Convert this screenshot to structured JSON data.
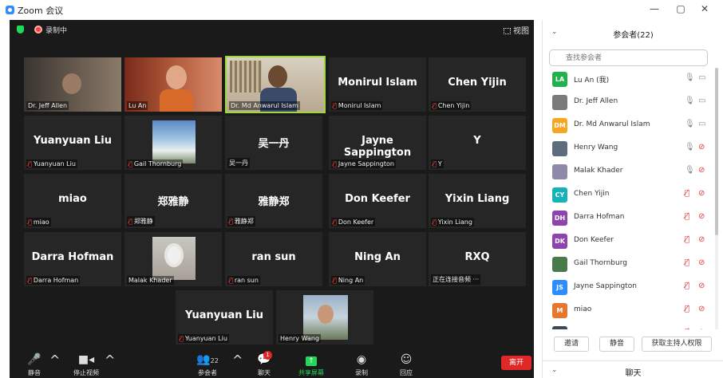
{
  "window": {
    "title": "Zoom 会议",
    "minimize": "—",
    "restore": "▢",
    "close": "✕"
  },
  "meeting": {
    "recording_label": "录制中",
    "view_label": "视图",
    "tiles": [
      {
        "name": "Dr. Jeff Allen",
        "big": "",
        "muted": false
      },
      {
        "name": "Lu An",
        "big": "",
        "muted": false
      },
      {
        "name": "Dr. Md Anwarul Islam",
        "big": "",
        "muted": false
      },
      {
        "name": "Monirul Islam",
        "big": "Monirul Islam",
        "muted": true
      },
      {
        "name": "Chen Yijin",
        "big": "Chen Yijin",
        "muted": true
      },
      {
        "name": "Yuanyuan Liu",
        "big": "Yuanyuan Liu",
        "muted": true
      },
      {
        "name": "Gail Thornburg",
        "big": "",
        "muted": true
      },
      {
        "name": "吴一丹",
        "big": "吴一丹",
        "muted": false
      },
      {
        "name": "Jayne Sappington",
        "big": "Jayne Sappington",
        "muted": true
      },
      {
        "name": "Y",
        "big": "Y",
        "muted": true
      },
      {
        "name": "miao",
        "big": "miao",
        "muted": true
      },
      {
        "name": "郑雅静",
        "big": "郑雅静",
        "muted": true
      },
      {
        "name": "雅静郑",
        "big": "雅静郑",
        "muted": true
      },
      {
        "name": "Don Keefer",
        "big": "Don Keefer",
        "muted": true
      },
      {
        "name": "Yixin Liang",
        "big": "Yixin Liang",
        "muted": true
      },
      {
        "name": "Darra Hofman",
        "big": "Darra Hofman",
        "muted": true
      },
      {
        "name": "Malak Khader",
        "big": "",
        "muted": false
      },
      {
        "name": "ran sun",
        "big": "ran sun",
        "muted": true
      },
      {
        "name": "Ning An",
        "big": "Ning An",
        "muted": true
      },
      {
        "name": "正在连接音频 ···",
        "big": "RXQ",
        "muted": false
      },
      {
        "name": "Yuanyuan Liu",
        "big": "Yuanyuan Liu",
        "muted": true
      },
      {
        "name": "Henry Wang",
        "big": "",
        "muted": false
      }
    ]
  },
  "toolbar": {
    "mute": "静音",
    "stop_video": "停止视频",
    "participants": "参会者",
    "participants_count": "22",
    "chat": "聊天",
    "chat_badge": "1",
    "share_screen": "共享屏幕",
    "record": "录制",
    "reactions": "回应",
    "leave": "离开"
  },
  "panel": {
    "title": "参会者(22)",
    "search_placeholder": "查找参会者",
    "participants": [
      {
        "initials": "LA",
        "name": "Lu An (我)",
        "color": "#23b14d",
        "photo": false,
        "mic_muted": false,
        "cam_off": false
      },
      {
        "initials": "",
        "name": "Dr. Jeff Allen",
        "color": "#7a7a7a",
        "photo": true,
        "mic_muted": false,
        "cam_off": false
      },
      {
        "initials": "DM",
        "name": "Dr. Md Anwarul Islam",
        "color": "#f5a623",
        "photo": false,
        "mic_muted": false,
        "cam_off": false
      },
      {
        "initials": "",
        "name": "Henry Wang",
        "color": "#5d6d7e",
        "photo": true,
        "mic_muted": false,
        "cam_off": true
      },
      {
        "initials": "",
        "name": "Malak Khader",
        "color": "#8e8aa8",
        "photo": true,
        "mic_muted": false,
        "cam_off": true
      },
      {
        "initials": "CY",
        "name": "Chen Yijin",
        "color": "#15b2b8",
        "photo": false,
        "mic_muted": true,
        "cam_off": true
      },
      {
        "initials": "DH",
        "name": "Darra Hofman",
        "color": "#8e44ad",
        "photo": false,
        "mic_muted": true,
        "cam_off": true
      },
      {
        "initials": "DK",
        "name": "Don Keefer",
        "color": "#8e44ad",
        "photo": false,
        "mic_muted": true,
        "cam_off": true
      },
      {
        "initials": "",
        "name": "Gail Thornburg",
        "color": "#4a7a4a",
        "photo": true,
        "mic_muted": true,
        "cam_off": true
      },
      {
        "initials": "JS",
        "name": "Jayne Sappington",
        "color": "#2d8cff",
        "photo": false,
        "mic_muted": true,
        "cam_off": true
      },
      {
        "initials": "M",
        "name": "miao",
        "color": "#e8772e",
        "photo": false,
        "mic_muted": true,
        "cam_off": true
      },
      {
        "initials": "",
        "name": "",
        "color": "#3a4a5a",
        "photo": true,
        "mic_muted": true,
        "cam_off": true
      }
    ],
    "invite": "邀请",
    "mute_all": "静音",
    "claim_host": "获取主持人权限",
    "chat_title": "聊天"
  }
}
